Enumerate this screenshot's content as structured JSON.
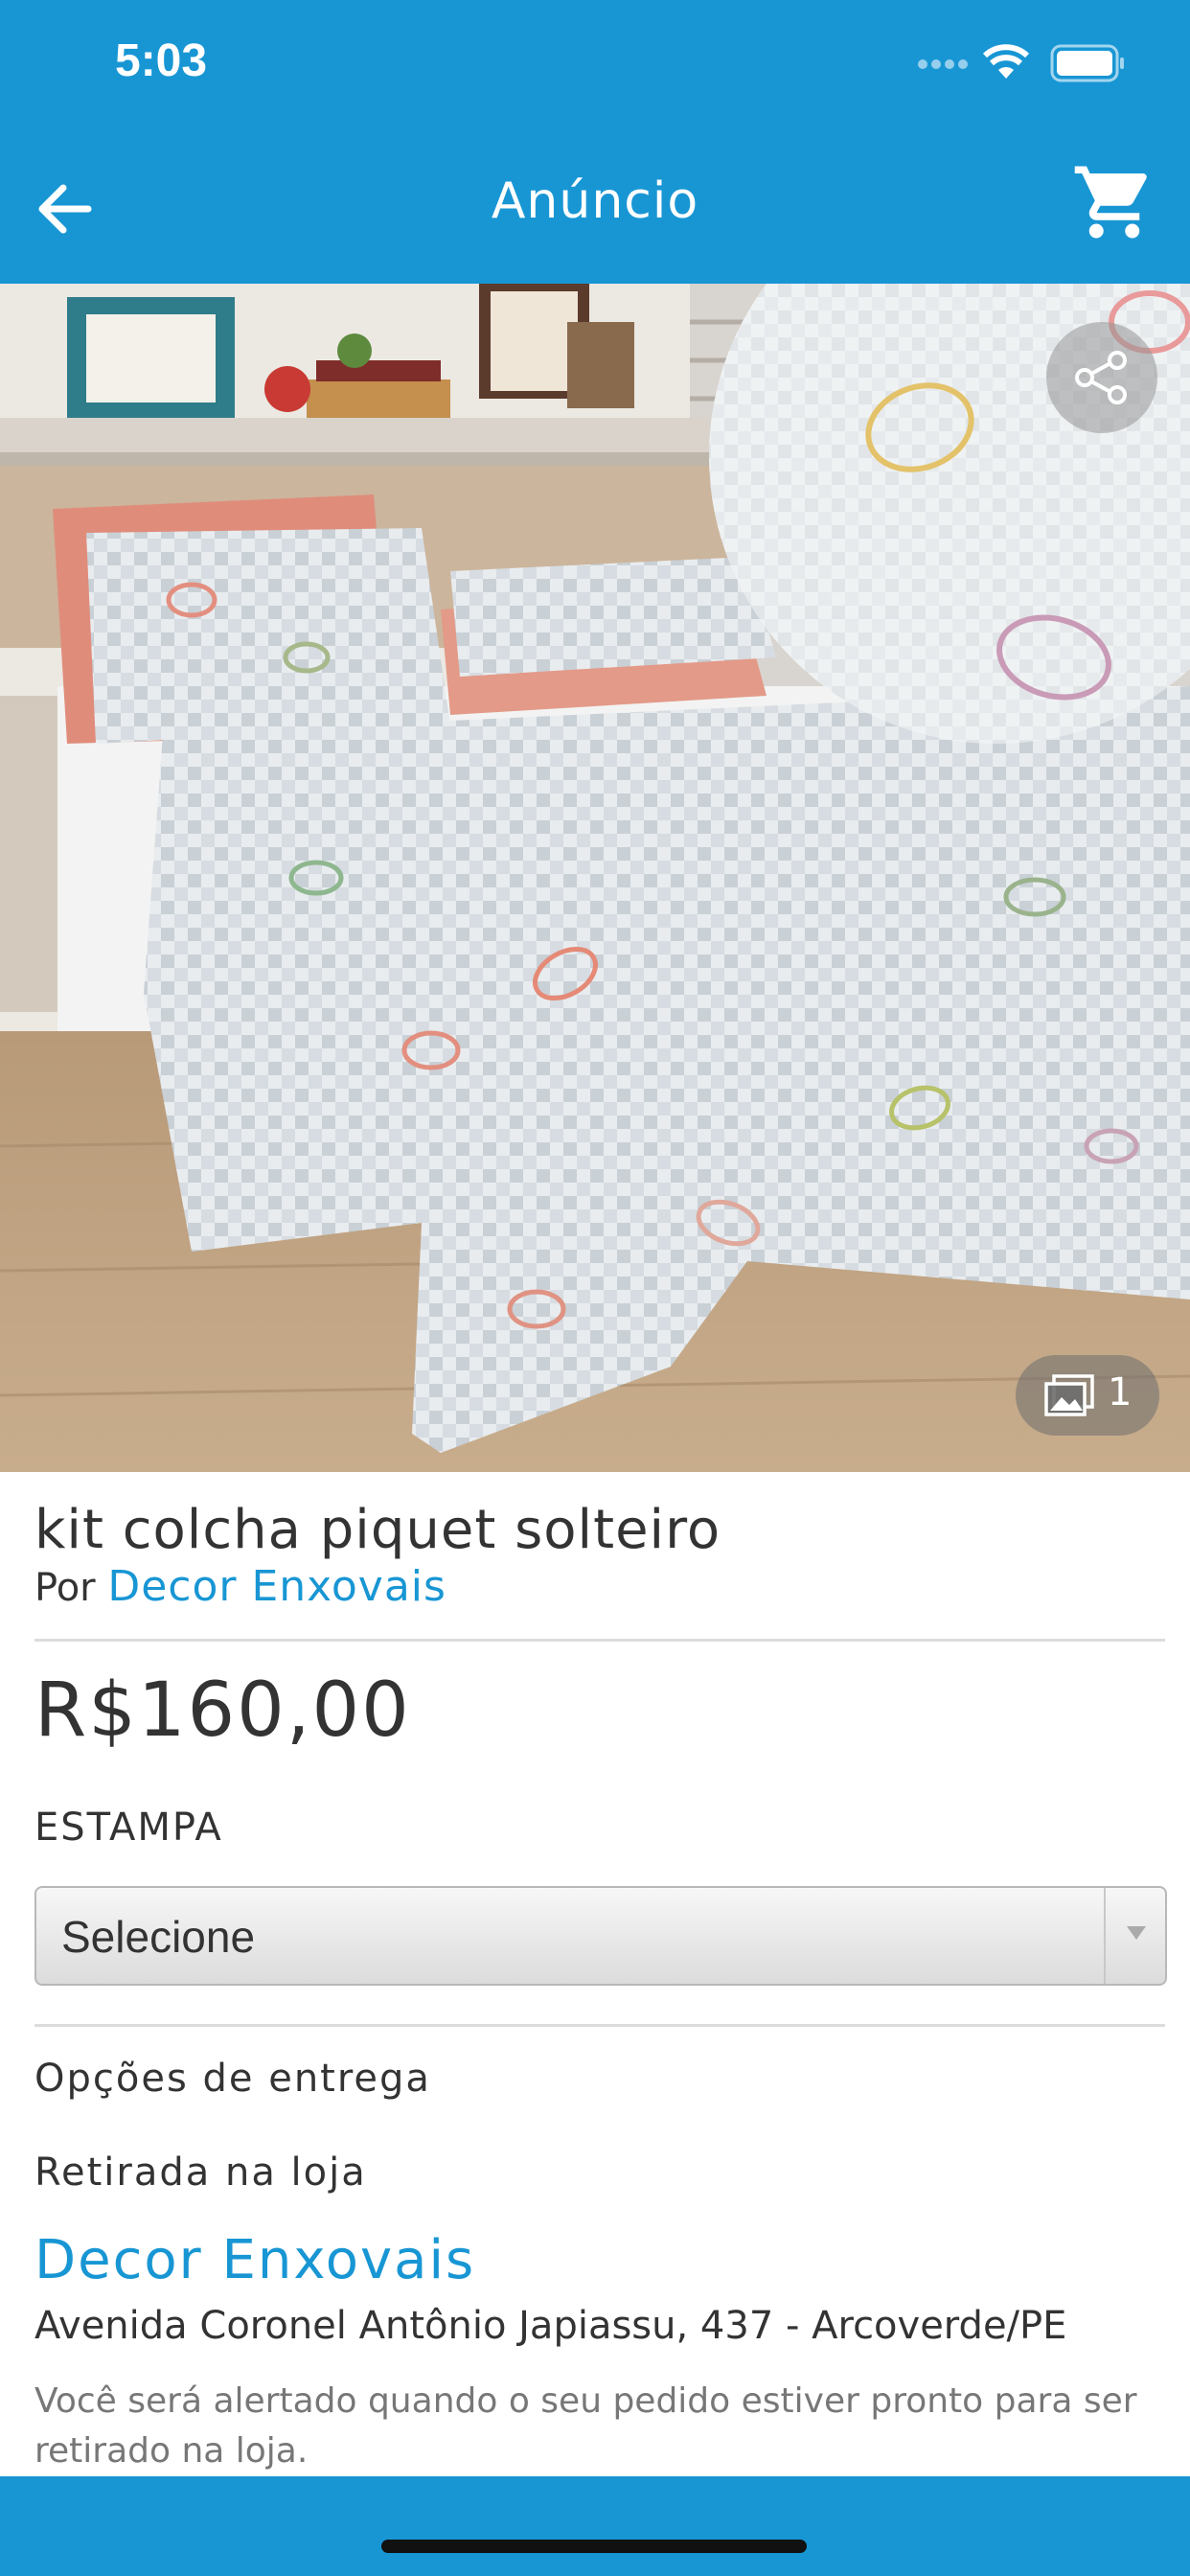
{
  "status_bar": {
    "time": "5:03"
  },
  "nav": {
    "title": "Anúncio"
  },
  "gallery": {
    "photo_count": "1"
  },
  "product": {
    "title": "kit colcha piquet solteiro",
    "by_prefix": "Por",
    "seller": "Decor Enxovais",
    "price": "R$160,00",
    "option_label": "ESTAMPA",
    "option_selected": "Selecione"
  },
  "delivery": {
    "heading": "Opções de entrega",
    "pickup_heading": "Retirada na loja",
    "store_name": "Decor Enxovais",
    "address": "Avenida Coronel Antônio Japiassu, 437 - Arcoverde/PE",
    "notice": "Você será alertado quando o seu pedido estiver pronto para ser retirado na loja."
  },
  "colors": {
    "brand": "#1896d4",
    "link": "#1896d4"
  }
}
